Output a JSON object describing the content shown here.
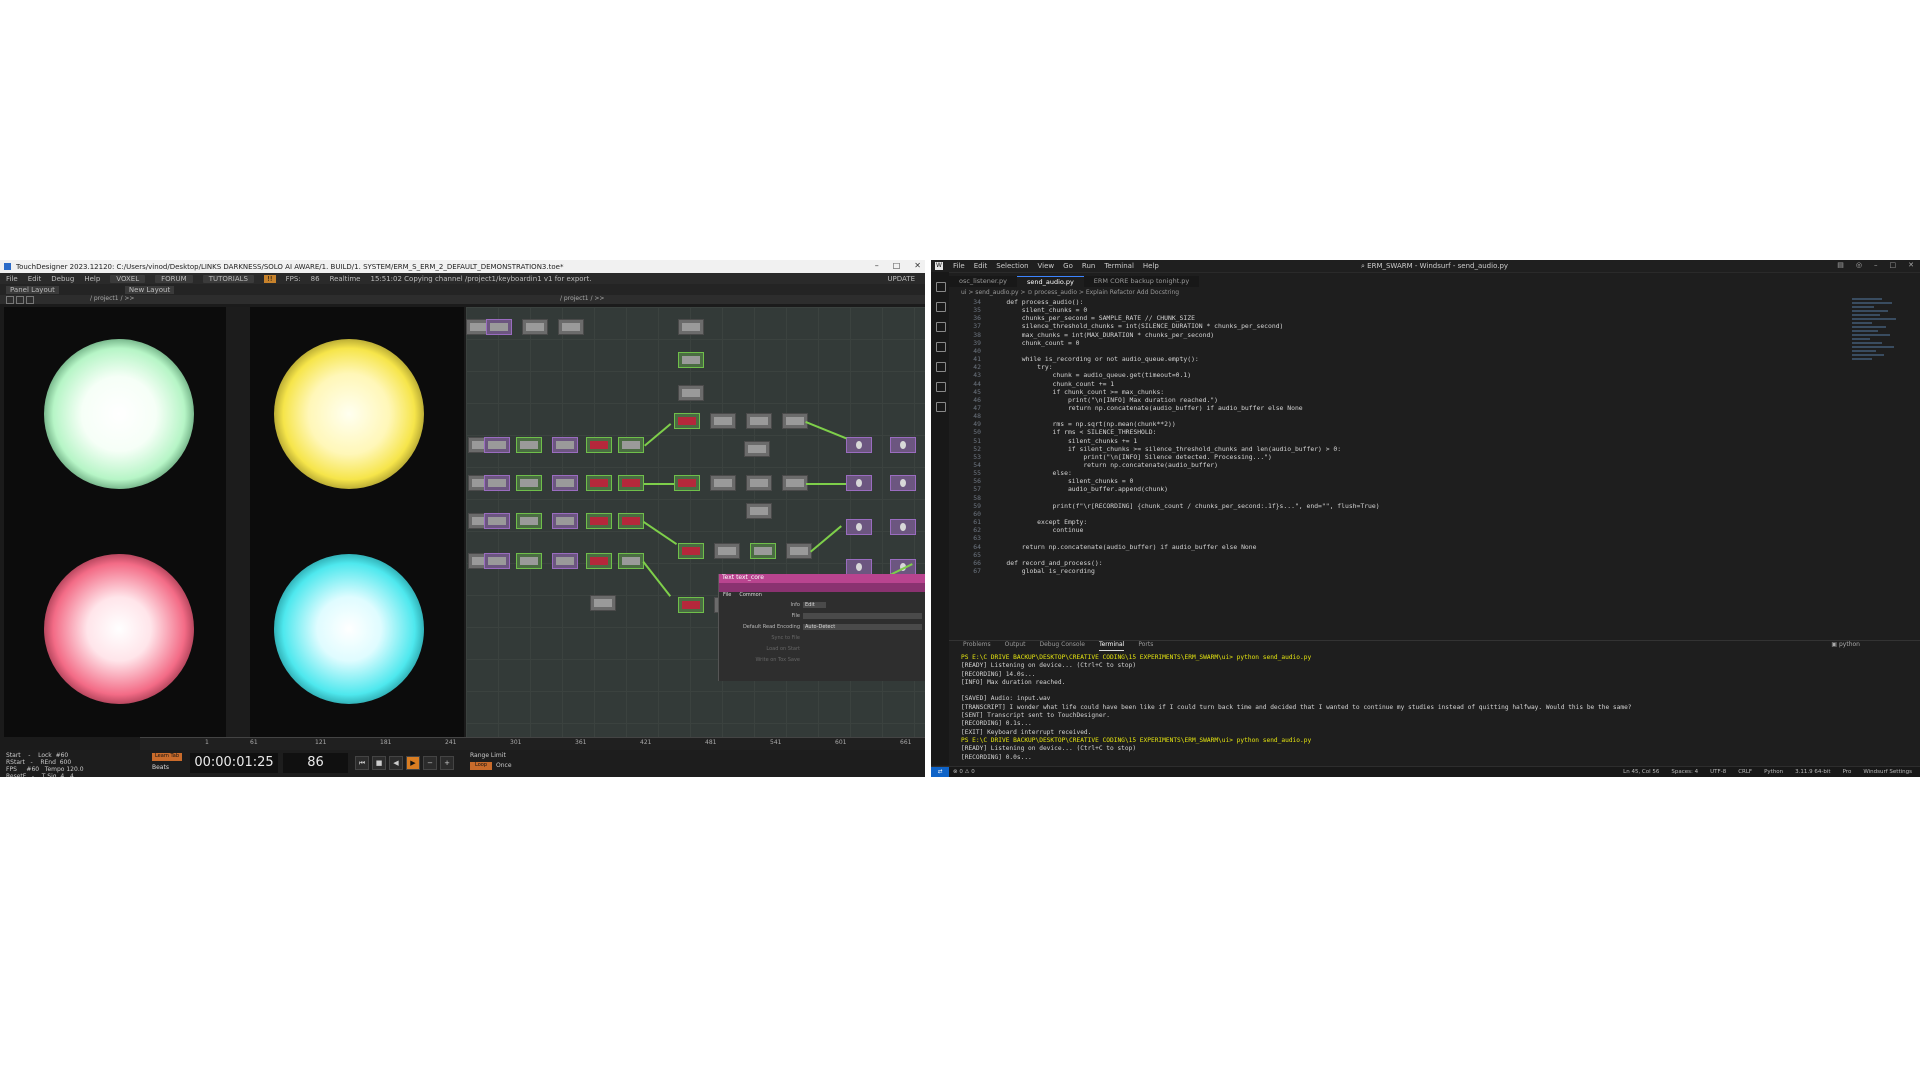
{
  "td": {
    "title": "TouchDesigner 2023.12120: C:/Users/vinod/Desktop/LINKS DARKNESS/SOLO AI AWARE/1. BUILD/1. SYSTEM/ERM_S_ERM_2_DEFAULT_DEMONSTRATION3.toe*",
    "menu": [
      "File",
      "Edit",
      "Debug",
      "Help"
    ],
    "menu_buttons": [
      "VOXEL",
      "FORUM",
      "TUTORIALS"
    ],
    "fps_label": "FPS:",
    "fps_value": "86",
    "realtime_label": "Realtime",
    "status_msg": "15:51:02 Copying channel /project1/keyboardin1 v1 for export.",
    "update_label": "UPDATE",
    "toolbar": [
      "Panel Layout",
      "New Layout"
    ],
    "path": "/ project1 / >>",
    "net_path": "/ project1 / >>",
    "params": {
      "op_type": "Text",
      "op_name": "text_core",
      "tabs": [
        "File",
        "Common"
      ],
      "info_label": "Info",
      "edit_button": "Edit",
      "file_label": "File",
      "encoding_label": "Default Read Encoding",
      "encoding_value": "Auto-Detect",
      "sync_label": "Sync to File",
      "load_label": "Load on Start",
      "write_label": "Write on Tox Save"
    },
    "timeline_ticks": [
      "1",
      "61",
      "121",
      "181",
      "241",
      "301",
      "361",
      "421",
      "481",
      "541",
      "601",
      "661"
    ],
    "perf": "Start    -    Lock  #60\nRStart   -    REnd  600\nFPS     #60   Tempo 120.0\nResetF   -    T Sig  4   4",
    "learn_label": "Learn Tab",
    "beats_label": "Beats",
    "timecode": "00:00:01:25",
    "frame": "86",
    "range_label": "Range Limit",
    "loop_label": "Loop",
    "once_label": "Once"
  },
  "ws": {
    "menu": [
      "File",
      "Edit",
      "Selection",
      "View",
      "Go",
      "Run",
      "Terminal",
      "Help"
    ],
    "window_title": "ERM_SWARM - Windsurf - send_audio.py",
    "tabs": [
      {
        "label": "osc_listener.py",
        "active": false
      },
      {
        "label": "send_audio.py",
        "active": true
      },
      {
        "label": "ERM CORE backup tonight.py",
        "active": false
      }
    ],
    "breadcrumb": "ui > send_audio.py > ⊙ process_audio > Explain   Refactor   Add Docstring",
    "code_lines": [
      {
        "n": "34",
        "t": "    def process_audio():"
      },
      {
        "n": "35",
        "t": "        silent_chunks = 0"
      },
      {
        "n": "36",
        "t": "        chunks_per_second = SAMPLE_RATE // CHUNK_SIZE"
      },
      {
        "n": "37",
        "t": "        silence_threshold_chunks = int(SILENCE_DURATION * chunks_per_second)"
      },
      {
        "n": "38",
        "t": "        max_chunks = int(MAX_DURATION * chunks_per_second)"
      },
      {
        "n": "39",
        "t": "        chunk_count = 0"
      },
      {
        "n": "40",
        "t": ""
      },
      {
        "n": "41",
        "t": "        while is_recording or not audio_queue.empty():"
      },
      {
        "n": "42",
        "t": "            try:"
      },
      {
        "n": "43",
        "t": "                chunk = audio_queue.get(timeout=0.1)"
      },
      {
        "n": "44",
        "t": "                chunk_count += 1"
      },
      {
        "n": "45",
        "t": "                if chunk_count >= max_chunks:"
      },
      {
        "n": "46",
        "t": "                    print(\"\\n[INFO] Max duration reached.\")"
      },
      {
        "n": "47",
        "t": "                    return np.concatenate(audio_buffer) if audio_buffer else None"
      },
      {
        "n": "48",
        "t": ""
      },
      {
        "n": "49",
        "t": "                rms = np.sqrt(np.mean(chunk**2))"
      },
      {
        "n": "50",
        "t": "                if rms < SILENCE_THRESHOLD:"
      },
      {
        "n": "51",
        "t": "                    silent_chunks += 1"
      },
      {
        "n": "52",
        "t": "                    if silent_chunks >= silence_threshold_chunks and len(audio_buffer) > 0:"
      },
      {
        "n": "53",
        "t": "                        print(\"\\n[INFO] Silence detected. Processing...\")"
      },
      {
        "n": "54",
        "t": "                        return np.concatenate(audio_buffer)"
      },
      {
        "n": "55",
        "t": "                else:"
      },
      {
        "n": "56",
        "t": "                    silent_chunks = 0"
      },
      {
        "n": "57",
        "t": "                    audio_buffer.append(chunk)"
      },
      {
        "n": "58",
        "t": ""
      },
      {
        "n": "59",
        "t": "                print(f\"\\r[RECORDING] {chunk_count / chunks_per_second:.1f}s...\", end=\"\", flush=True)"
      },
      {
        "n": "60",
        "t": ""
      },
      {
        "n": "61",
        "t": "            except Empty:"
      },
      {
        "n": "62",
        "t": "                continue"
      },
      {
        "n": "63",
        "t": ""
      },
      {
        "n": "64",
        "t": "        return np.concatenate(audio_buffer) if audio_buffer else None"
      },
      {
        "n": "65",
        "t": ""
      },
      {
        "n": "66",
        "t": "    def record_and_process():"
      },
      {
        "n": "67",
        "t": "        global is_recording"
      }
    ],
    "panel_tabs": [
      "Problems",
      "Output",
      "Debug Console",
      "Terminal",
      "Ports"
    ],
    "panel_active": "Terminal",
    "terminal_shell": "python",
    "terminal_lines": [
      "PS E:\\C DRIVE BACKUP\\DESKTOP\\CREATIVE CODING\\15 EXPERIMENTS\\ERM_SWARM\\ui> python send_audio.py",
      "[READY] Listening on device... (Ctrl+C to stop)",
      "[RECORDING] 14.0s...",
      "[INFO] Max duration reached.",
      "",
      "[SAVED] Audio: input.wav",
      "[TRANSCRIPT] I wonder what life could have been like if I could turn back time and decided that I wanted to continue my studies instead of quitting halfway. Would this be the same?",
      "[SENT] Transcript sent to TouchDesigner.",
      "[RECORDING] 0.1s...",
      "[EXIT] Keyboard interrupt received.",
      "PS E:\\C DRIVE BACKUP\\DESKTOP\\CREATIVE CODING\\15 EXPERIMENTS\\ERM_SWARM\\ui> python send_audio.py",
      "[READY] Listening on device... (Ctrl+C to stop)",
      "[RECORDING] 0.0s..."
    ],
    "status": {
      "errors": "⊗ 0 ⚠ 0",
      "position": "Ln 45, Col 56",
      "spaces": "Spaces: 4",
      "encoding": "UTF-8",
      "eol": "CRLF",
      "language": "Python",
      "version": "3.11.9 64-bit",
      "pro": "Pro",
      "settings": "Windsurf Settings"
    }
  }
}
